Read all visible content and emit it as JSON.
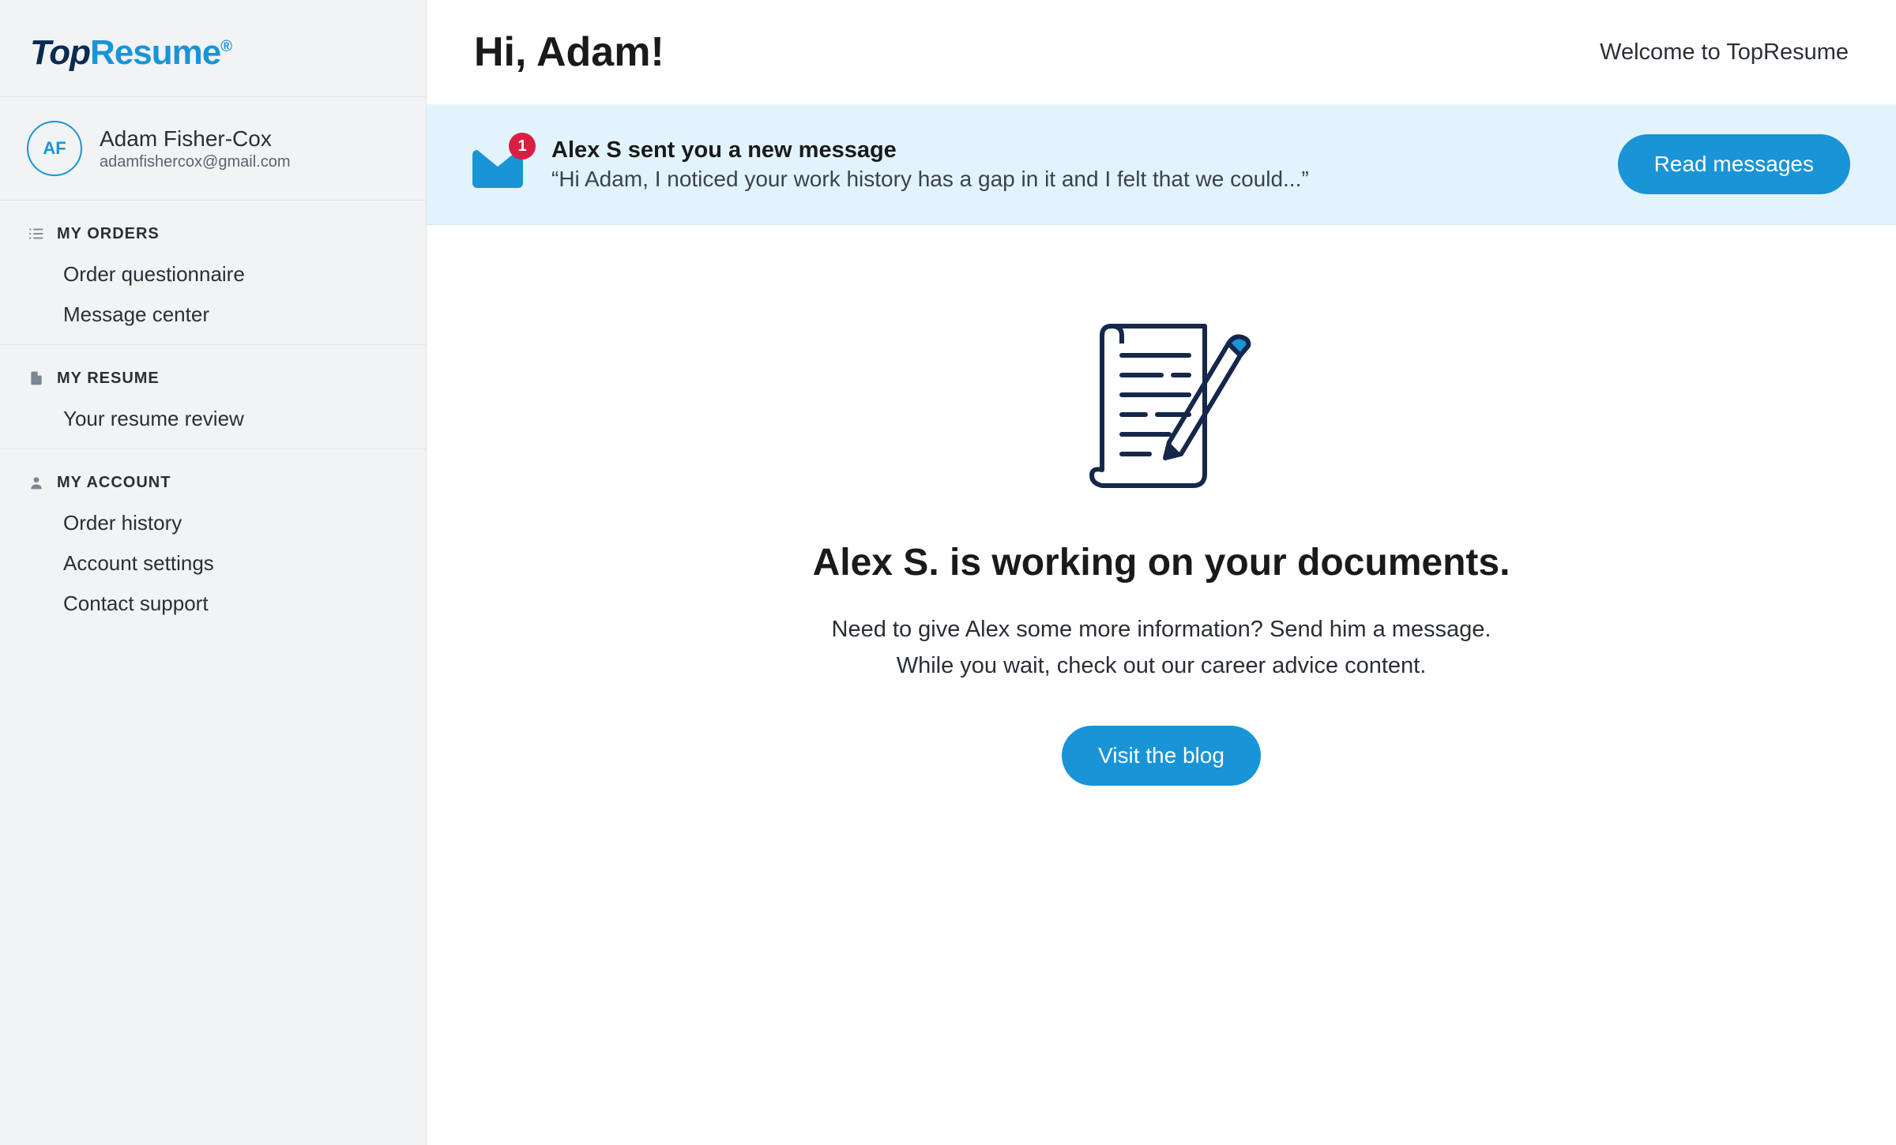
{
  "brand": {
    "part1": "Top",
    "part2": "Resume",
    "reg": "®"
  },
  "profile": {
    "initials": "AF",
    "name": "Adam Fisher-Cox",
    "email": "adamfishercox@gmail.com"
  },
  "nav": {
    "orders": {
      "head": "My Orders",
      "items": [
        "Order questionnaire",
        "Message center"
      ]
    },
    "resume": {
      "head": "My Resume",
      "items": [
        "Your resume review"
      ]
    },
    "account": {
      "head": "My Account",
      "items": [
        "Order history",
        "Account settings",
        "Contact support"
      ]
    }
  },
  "header": {
    "greeting": "Hi, Adam!",
    "welcome": "Welcome to TopResume"
  },
  "banner": {
    "badge": "1",
    "title": "Alex S sent you a new message",
    "preview": "“Hi Adam, I noticed your work history has a gap in it and I felt that we could...”",
    "button": "Read messages"
  },
  "empty": {
    "title": "Alex S. is working on your documents.",
    "line1": "Need to give Alex some more information? Send him a message.",
    "line2": "While you wait, check out our career advice content.",
    "button": "Visit the blog"
  }
}
